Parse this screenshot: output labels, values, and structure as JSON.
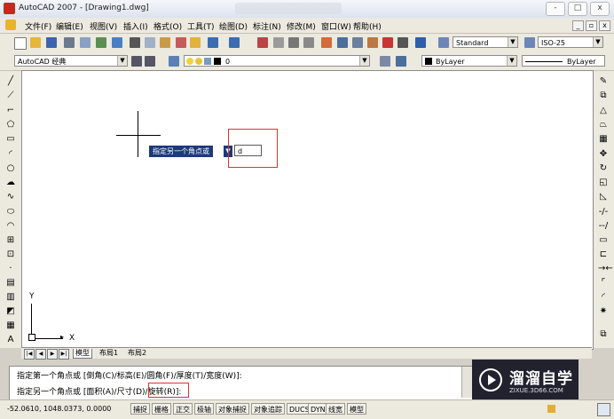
{
  "titlebar": {
    "title": "AutoCAD 2007 - [Drawing1.dwg]",
    "min": "-",
    "max": "□",
    "close": "x"
  },
  "menubar": {
    "items": [
      "文件(F)",
      "编辑(E)",
      "视图(V)",
      "插入(I)",
      "格式(O)",
      "工具(T)",
      "绘图(D)",
      "标注(N)",
      "修改(M)",
      "窗口(W)",
      "帮助(H)"
    ],
    "mdi_min": "_",
    "mdi_restore": "▫",
    "mdi_close": "x"
  },
  "toolbar1": {
    "text_style": "Standard",
    "dim_style": "ISO-25"
  },
  "toolbar2": {
    "workspace": "AutoCAD 经典",
    "layer": "0",
    "color": "ByLayer",
    "linetype": "ByLayer"
  },
  "drawing": {
    "prompt_label": "指定另一个角点或",
    "input_value": "d",
    "ucs_y": "Y",
    "ucs_x": "X"
  },
  "tabs": {
    "nav": [
      "|◀",
      "◀",
      "▶",
      "▶|"
    ],
    "items": [
      "模型",
      "布局1",
      "布局2"
    ]
  },
  "command": {
    "line1": "指定第一个角点或 [倒角(C)/标高(E)/圆角(F)/厚度(T)/宽度(W)]:",
    "line2": "指定另一个角点或 [面积(A)/尺寸(D)/旋转(R)]:"
  },
  "status": {
    "coords": "-52.0610,  1048.0373, 0.0000",
    "buttons": [
      "捕捉",
      "栅格",
      "正交",
      "极轴",
      "对象捕捉",
      "对象追踪",
      "DUCS",
      "DYN",
      "线宽",
      "模型"
    ]
  },
  "watermark": {
    "brand": "溜溜自学",
    "url": "ZIXUE.3D66.COM"
  },
  "colors": {
    "accent_red": "#e0312f",
    "prompt_bg": "#1c3a79",
    "toolbar_bg": "#ece9df"
  }
}
